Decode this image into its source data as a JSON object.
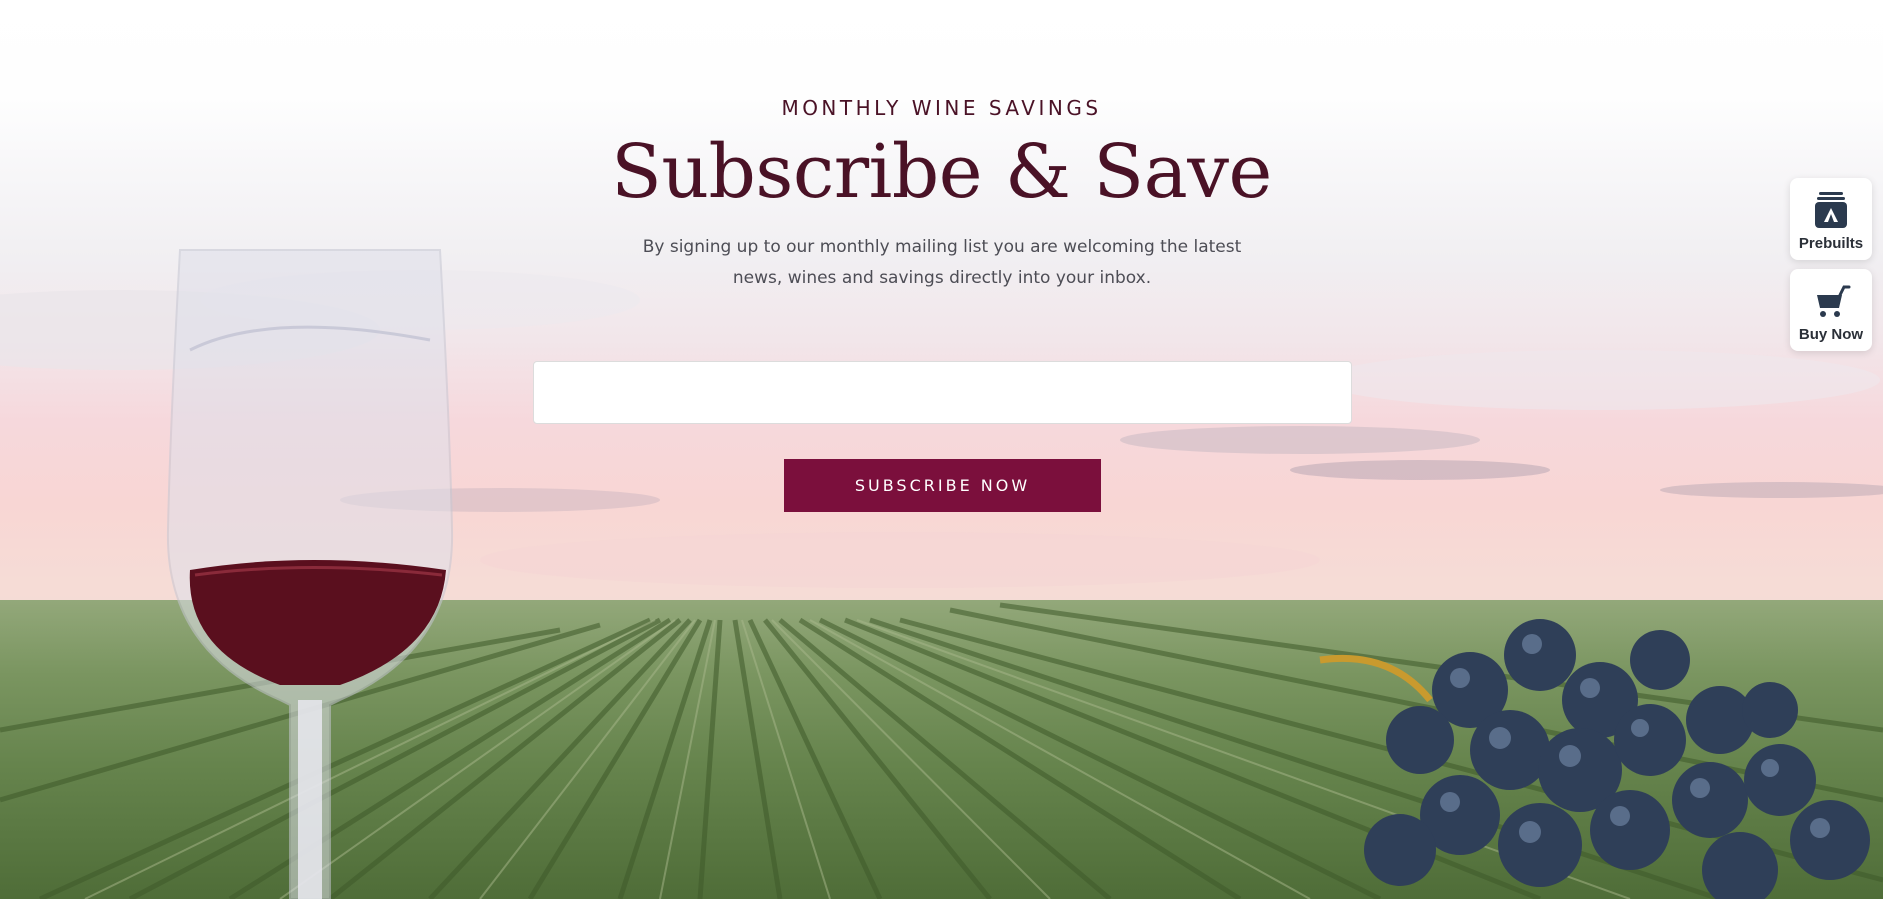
{
  "hero": {
    "eyebrow": "MONTHLY WINE SAVINGS",
    "title": "Subscribe & Save",
    "description": "By signing up to our monthly mailing list you are welcoming the latest news, wines and savings directly into your inbox.",
    "email_placeholder": "",
    "email_value": "",
    "subscribe_label": "SUBSCRIBE NOW"
  },
  "side_widgets": [
    {
      "label": "Prebuilts",
      "icon": "prebuilts-icon"
    },
    {
      "label": "Buy Now",
      "icon": "cart-icon"
    }
  ],
  "colors": {
    "accent": "#7b0f3c",
    "heading": "#4a1226",
    "body_text": "#4d4d55"
  }
}
